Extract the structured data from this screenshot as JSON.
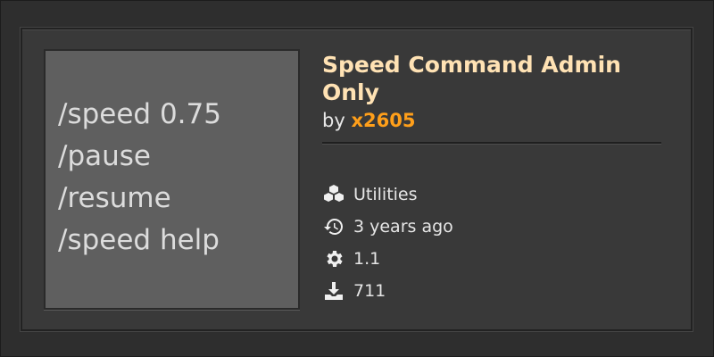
{
  "thumbnail": {
    "lines": [
      "/speed 0.75",
      "/pause",
      "/resume",
      "/speed help"
    ]
  },
  "mod": {
    "title": "Speed Command Admin Only",
    "by_label": "by",
    "author": "x2605"
  },
  "meta": {
    "category": "Utilities",
    "updated": "3 years ago",
    "version": "1.1",
    "downloads": "711"
  },
  "icons": {
    "category": "cubes-icon",
    "updated": "history-icon",
    "version": "gear-icon",
    "downloads": "download-icon"
  },
  "colors": {
    "title": "#ffe2b4",
    "author": "#ff9f1a",
    "background": "#393939"
  }
}
